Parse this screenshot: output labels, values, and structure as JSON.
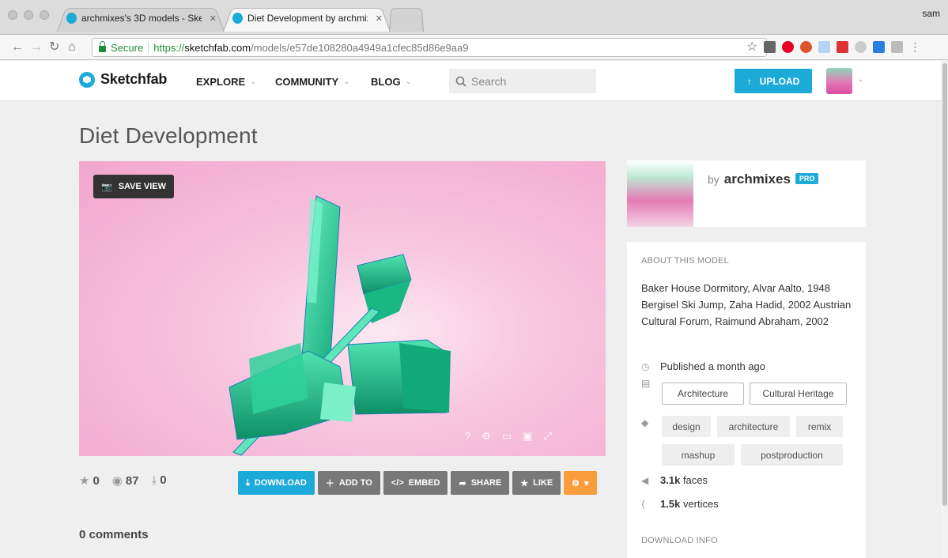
{
  "browser": {
    "tabs": [
      {
        "title": "archmixes's 3D models - Sketc"
      },
      {
        "title": "Diet Development by archmixe"
      }
    ],
    "user": "sam",
    "secure_label": "Secure",
    "url": {
      "scheme": "https://",
      "host": "sketchfab.com",
      "path": "/models/e57de108280a4949a1cfec85d86e9aa9"
    }
  },
  "header": {
    "logo": "Sketchfab",
    "menu": [
      {
        "label": "EXPLORE"
      },
      {
        "label": "COMMUNITY"
      },
      {
        "label": "BLOG"
      }
    ],
    "search_placeholder": "Search",
    "upload_label": "UPLOAD"
  },
  "model": {
    "title": "Diet Development",
    "save_view_label": "SAVE VIEW",
    "stats": {
      "likes": "0",
      "views": "87",
      "downloads": "0"
    },
    "actions": {
      "download": "DOWNLOAD",
      "add_to": "ADD TO",
      "embed": "EMBED",
      "share": "SHARE",
      "like": "LIKE"
    },
    "comments_label": "0 comments"
  },
  "author": {
    "by": "by",
    "name": "archmixes",
    "badge": "PRO"
  },
  "about": {
    "heading": "ABOUT THIS MODEL",
    "description": "Baker House Dormitory, Alvar Aalto, 1948 Bergisel Ski Jump, Zaha Hadid, 2002 Austrian Cultural Forum, Raimund Abraham, 2002",
    "published": "Published a month ago",
    "categories": [
      "Architecture",
      "Cultural Heritage"
    ],
    "tags": [
      "design",
      "architecture",
      "remix",
      "mashup",
      "postproduction"
    ],
    "faces": {
      "value": "3.1k",
      "unit": "faces"
    },
    "vertices": {
      "value": "1.5k",
      "unit": "vertices"
    },
    "download_heading": "DOWNLOAD INFO"
  },
  "colors": {
    "accent": "#1caad9",
    "action_gray": "#787878",
    "action_orange": "#f89c3c",
    "viewer_bg": "#f5b5d6",
    "model_green": "#2fd19a"
  }
}
